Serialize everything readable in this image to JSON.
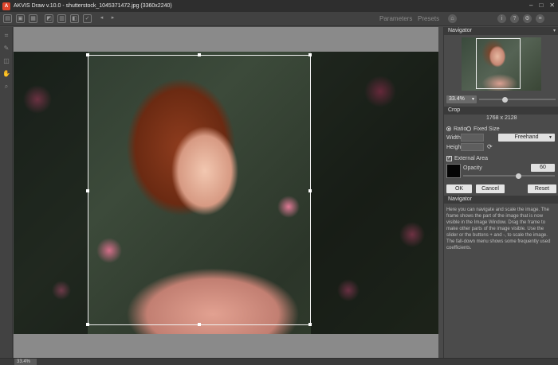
{
  "window": {
    "logo": "A",
    "title": "AKVIS Draw v.10.0 - shutterstock_1045371472.jpg (3360x2240)",
    "controls": [
      "–",
      "□",
      "✕"
    ]
  },
  "toolbar": {
    "icons": [
      "open-icon",
      "save-icon",
      "print-icon",
      "share-icon",
      "batch-icon",
      "before-after-icon",
      "apply-icon",
      "undo-icon",
      "redo-icon"
    ],
    "parameters_label": "Parameters",
    "presets_label": "Presets",
    "right_icons": [
      "home-icon",
      "info-icon",
      "help-icon",
      "settings-icon",
      "news-icon"
    ]
  },
  "tools": [
    "crop-tool",
    "brush-tool",
    "eraser-tool",
    "hand-tool",
    "zoom-tool"
  ],
  "status": {
    "zoom": "33.4%"
  },
  "navigator": {
    "title": "Navigator",
    "zoom": "33.4%"
  },
  "crop": {
    "title": "Crop",
    "dimensions": "1768 x 2128",
    "ratio_label": "Ratio",
    "fixed_size_label": "Fixed Size",
    "width_label": "Width",
    "height_label": "Height",
    "mode": "Freehand",
    "external_area_label": "External Area",
    "opacity_label": "Opacity",
    "opacity_value": "60",
    "opacity_level": 0.6,
    "ok_label": "OK",
    "cancel_label": "Cancel",
    "reset_label": "Reset"
  },
  "help": {
    "title": "Navigator",
    "text": "Here you can navigate and scale the image. The frame shows the part of the image that is now visible in the Image Window. Drag the frame to make other parts of the image visible. Use the slider or the buttons + and -, to scale the image. The fall-down menu shows some frequently used coefficients."
  },
  "colors": {
    "accent": "#e0452c",
    "background": "#4a4a4a",
    "panel_header": "#3a3a3a"
  }
}
